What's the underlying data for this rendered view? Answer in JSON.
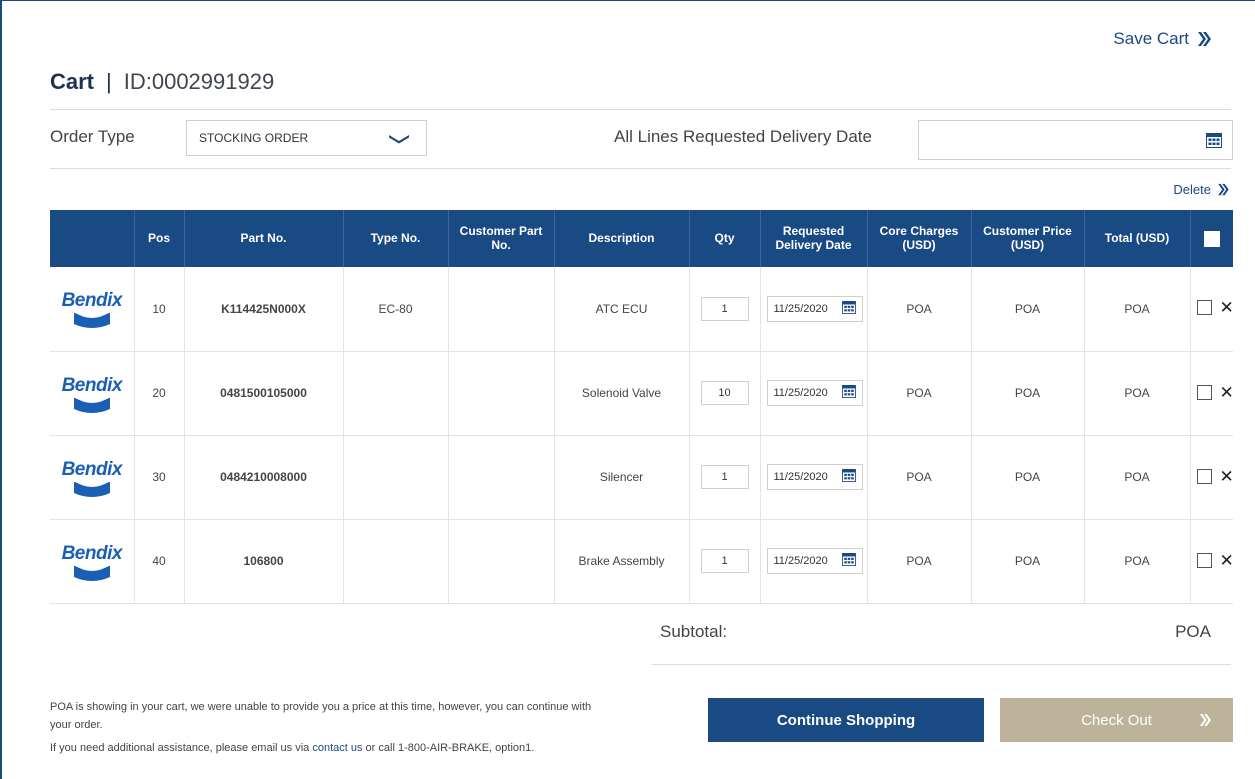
{
  "header": {
    "save_cart_label": "Save Cart",
    "cart_label": "Cart",
    "separator": "|",
    "cart_id": "ID:0002991929"
  },
  "order": {
    "order_type_label": "Order Type",
    "order_type_value": "STOCKING ORDER",
    "delivery_date_label": "All Lines Requested Delivery Date",
    "delivery_date_value": ""
  },
  "delete_label": "Delete",
  "table": {
    "columns": [
      "",
      "Pos",
      "Part No.",
      "Type No.",
      "Customer Part No.",
      "Description",
      "Qty",
      "Requested Delivery Date",
      "Core Charges (USD)",
      "Customer Price (USD)",
      "Total (USD)",
      ""
    ],
    "rows": [
      {
        "brand": "Bendix",
        "pos": "10",
        "part_no": "K114425N000X",
        "type_no": "EC-80",
        "customer_part_no": "",
        "description": "ATC ECU",
        "qty": "1",
        "delivery_date": "11/25/2020",
        "core_charges": "POA",
        "customer_price": "POA",
        "total": "POA"
      },
      {
        "brand": "Bendix",
        "pos": "20",
        "part_no": "0481500105000",
        "type_no": "",
        "customer_part_no": "",
        "description": "Solenoid Valve",
        "qty": "10",
        "delivery_date": "11/25/2020",
        "core_charges": "POA",
        "customer_price": "POA",
        "total": "POA"
      },
      {
        "brand": "Bendix",
        "pos": "30",
        "part_no": "0484210008000",
        "type_no": "",
        "customer_part_no": "",
        "description": "Silencer",
        "qty": "1",
        "delivery_date": "11/25/2020",
        "core_charges": "POA",
        "customer_price": "POA",
        "total": "POA"
      },
      {
        "brand": "Bendix",
        "pos": "40",
        "part_no": "106800",
        "type_no": "",
        "customer_part_no": "",
        "description": "Brake Assembly",
        "qty": "1",
        "delivery_date": "11/25/2020",
        "core_charges": "POA",
        "customer_price": "POA",
        "total": "POA"
      }
    ]
  },
  "summary": {
    "subtotal_label": "Subtotal:",
    "subtotal_value": "POA"
  },
  "notes": {
    "poa_message": "POA is showing in your cart, we were unable to provide you a price at this time, however, you can continue with your order.",
    "help_prefix": "If you need additional assistance, please email us via",
    "contact_link": "contact us",
    "help_suffix": "or call 1-800-AIR-BRAKE, option1."
  },
  "buttons": {
    "continue_shopping": "Continue Shopping",
    "check_out": "Check Out"
  },
  "icons": {
    "save_cart": "double-chevron-right-icon",
    "order_type": "chevron-down-icon",
    "calendar": "calendar-icon",
    "remove": "close-icon"
  },
  "colors": {
    "brand_blue": "#1a4a84",
    "checkout_tan": "#bcb39a"
  }
}
